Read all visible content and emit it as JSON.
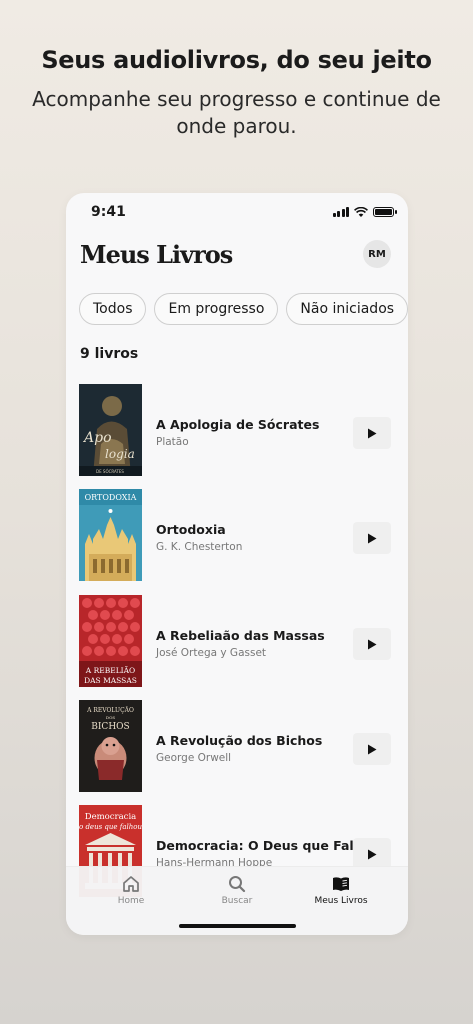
{
  "promo": {
    "headline": "Seus audiolivros, do seu jeito",
    "subline": "Acompanhe seu progresso e continue de onde parou."
  },
  "status": {
    "time": "9:41"
  },
  "header": {
    "title": "Meus Livros",
    "avatar_initials": "RM"
  },
  "filters": [
    "Todos",
    "Em progresso",
    "Não iniciados"
  ],
  "count_label": "9 livros",
  "books": [
    {
      "title": "A Apologia de Sócrates",
      "author": "Platão",
      "cover_text": [
        "Apo",
        "logia",
        "DE SÓCRATES"
      ]
    },
    {
      "title": "Ortodoxia",
      "author": "G. K. Chesterton",
      "cover_text": [
        "ORTODOXIA"
      ]
    },
    {
      "title": "A Rebeliaão das Massas",
      "author": "José Ortega y Gasset",
      "cover_text": [
        "A REBELIÃO",
        "DAS MASSAS"
      ]
    },
    {
      "title": "A Revolução dos Bichos",
      "author": "George Orwell",
      "cover_text": [
        "A REVOLUÇÃO",
        "DOS",
        "BICHOS"
      ]
    },
    {
      "title": "Democracia: O Deus que Falhou",
      "author": "Hans-Hermann Hoppe",
      "cover_text": [
        "Democracia",
        "o deus que falhou"
      ]
    }
  ],
  "tabs": [
    {
      "label": "Home",
      "icon": "home-icon"
    },
    {
      "label": "Buscar",
      "icon": "search-icon"
    },
    {
      "label": "Meus Livros",
      "icon": "book-icon"
    }
  ]
}
